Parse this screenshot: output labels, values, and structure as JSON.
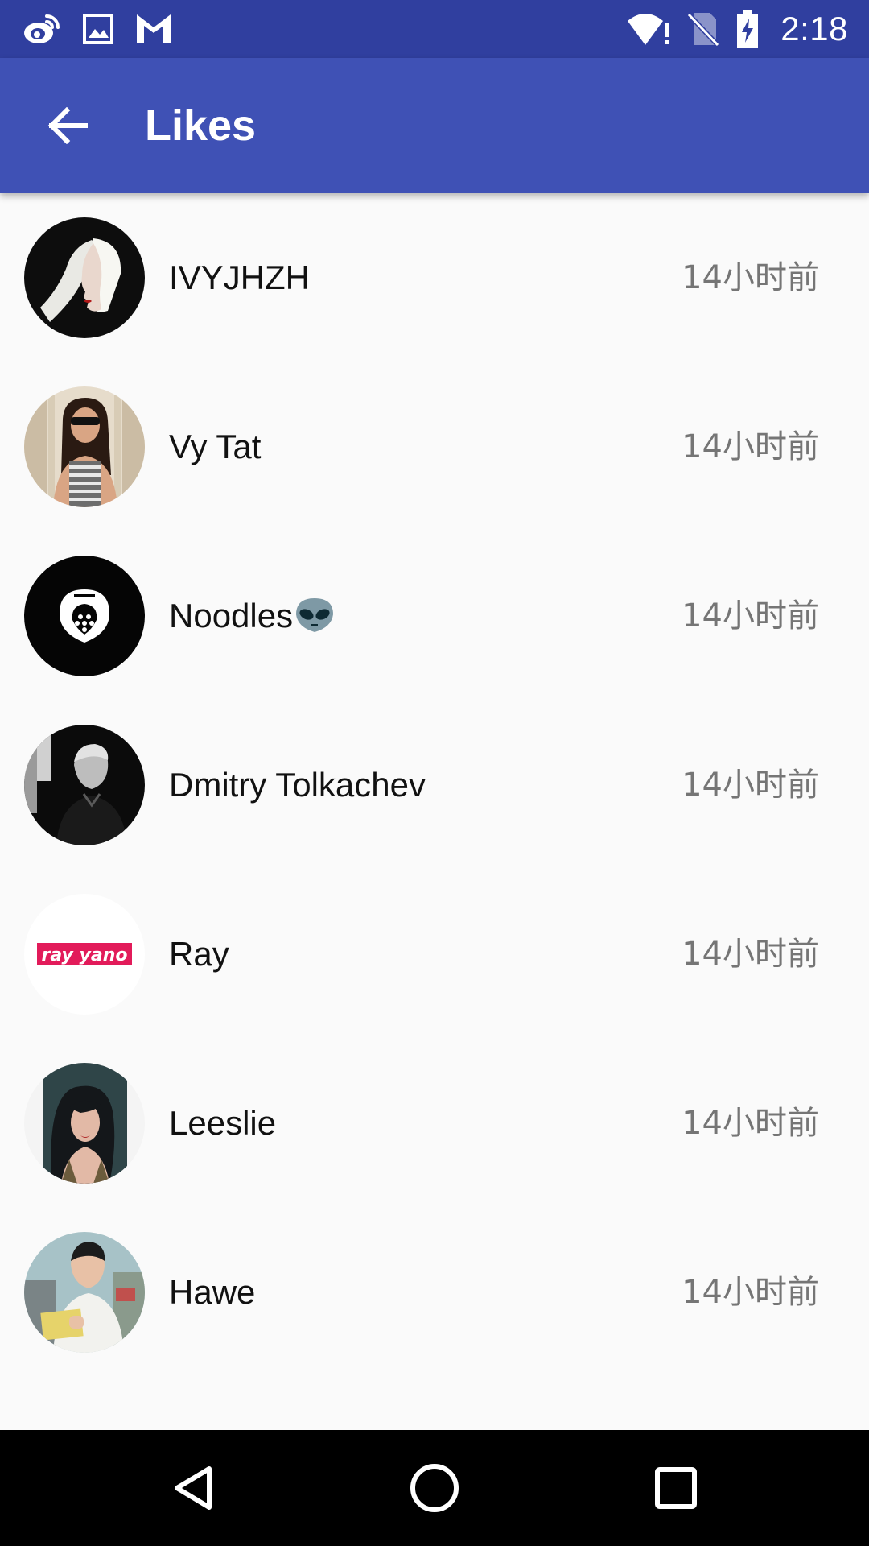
{
  "status_bar": {
    "time": "2:18",
    "left_icons": [
      "weibo-icon",
      "image-icon",
      "gmail-icon"
    ],
    "right_icons": [
      "wifi-alert-icon",
      "no-sim-icon",
      "battery-charging-icon"
    ]
  },
  "app_bar": {
    "title": "Likes",
    "back_icon": "arrow-back-icon",
    "background": "#3f51b5",
    "status_background": "#303f9f"
  },
  "likes": [
    {
      "name": "IVYJHZH",
      "time": "14小时前",
      "avatar": "avatar-nun-profile"
    },
    {
      "name": "Vy Tat",
      "time": "14小时前",
      "avatar": "avatar-woman-sunglasses"
    },
    {
      "name": "Noodles",
      "emoji": "alien-emoji",
      "time": "14小时前",
      "avatar": "avatar-noodles-logo"
    },
    {
      "name": "Dmitry Tolkachev",
      "time": "14小时前",
      "avatar": "avatar-bw-portrait"
    },
    {
      "name": "Ray",
      "time": "14小时前",
      "avatar": "avatar-rayyano-logo",
      "avatar_text": "ray yano"
    },
    {
      "name": "Leeslie",
      "time": "14小时前",
      "avatar": "avatar-woman-dark-hair"
    },
    {
      "name": "Hawe",
      "time": "14小时前",
      "avatar": "avatar-man-card"
    }
  ],
  "nav_bar": {
    "buttons": [
      "back-triangle-icon",
      "home-circle-icon",
      "recents-square-icon"
    ]
  }
}
